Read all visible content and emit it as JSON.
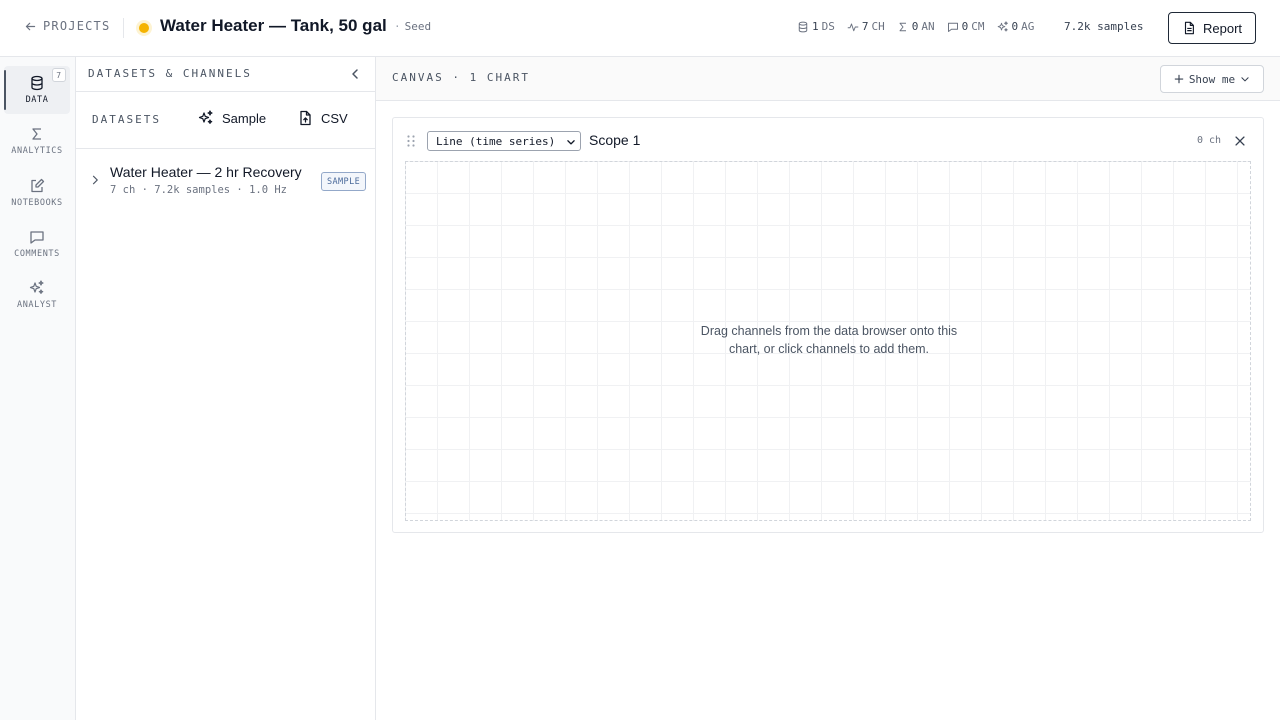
{
  "header": {
    "back_label": "PROJECTS",
    "title": "Water Heater — Tank, 50 gal",
    "tag": "Seed",
    "tag_separator": "·",
    "status_color": "#f5b301",
    "stats": [
      {
        "icon": "database-icon",
        "value": "1",
        "unit": "DS"
      },
      {
        "icon": "activity-icon",
        "value": "7",
        "unit": "CH"
      },
      {
        "icon": "sigma-icon",
        "value": "0",
        "unit": "AN"
      },
      {
        "icon": "comment-icon",
        "value": "0",
        "unit": "CM"
      },
      {
        "icon": "sparkles-icon",
        "value": "0",
        "unit": "AG"
      }
    ],
    "samples": "7.2k samples",
    "report_label": "Report"
  },
  "rail": {
    "items": [
      {
        "label": "DATA",
        "icon": "database-icon",
        "badge": "7",
        "active": true
      },
      {
        "label": "ANALYTICS",
        "icon": "sigma-icon"
      },
      {
        "label": "NOTEBOOKS",
        "icon": "notebook-icon"
      },
      {
        "label": "COMMENTS",
        "icon": "comment-icon"
      },
      {
        "label": "ANALYST",
        "icon": "sparkles-icon"
      }
    ]
  },
  "panel": {
    "title": "DATASETS & CHANNELS",
    "datasets_label": "DATASETS",
    "sample_label": "Sample",
    "csv_label": "CSV",
    "dataset": {
      "name": "Water Heater — 2 hr Recovery",
      "meta": "7 ch · 7.2k samples · 1.0 Hz",
      "badge": "SAMPLE"
    }
  },
  "canvas": {
    "title": "CANVAS · 1 CHART",
    "show_me_label": "Show me",
    "chart": {
      "type_selected": "Line (time series)",
      "name": "Scope 1",
      "channel_count": "0 ch",
      "empty_line1": "Drag channels from the data browser onto this",
      "empty_line2": "chart, or click channels to add them."
    }
  }
}
